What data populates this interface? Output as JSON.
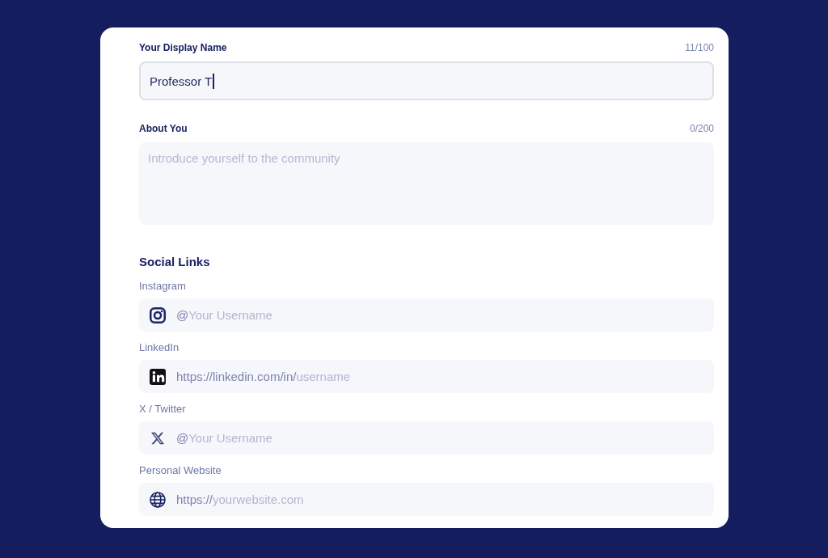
{
  "profile_form": {
    "fields": [
      {
        "kind": "text",
        "label": "Your Display Name",
        "counter": "11/100",
        "value": "Professor T",
        "focused": true
      },
      {
        "kind": "textarea",
        "label": "About You",
        "counter": "0/200",
        "placeholder": "Introduce yourself to the community"
      }
    ],
    "social_links": {
      "title": "Social Links",
      "items": [
        {
          "kind": "instagram",
          "label": "Instagram",
          "prefix": "@",
          "placeholder": "Your Username"
        },
        {
          "kind": "linkedin",
          "label": "LinkedIn",
          "prefix": "https://linkedin.com/in/",
          "placeholder": "username"
        },
        {
          "kind": "x",
          "label": "X / Twitter",
          "prefix": "@",
          "placeholder": "Your Username"
        },
        {
          "kind": "website",
          "label": "Personal Website",
          "prefix": "https://",
          "placeholder": "yourwebsite.com"
        }
      ]
    }
  }
}
